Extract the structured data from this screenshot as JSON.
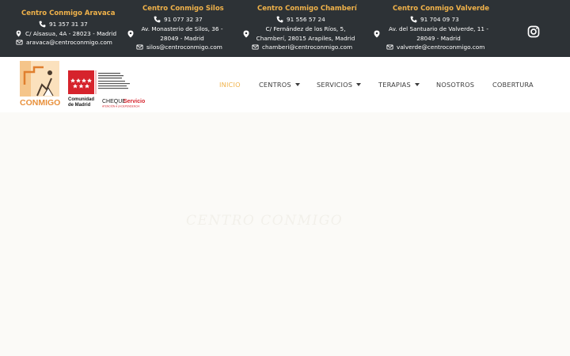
{
  "centers": [
    {
      "name": "Centro Conmigo Aravaca",
      "phone": "91 357 31 37",
      "address": "C/ Alsasua, 4A - 28023 - Madrid",
      "email": "aravaca@centroconmigo.com"
    },
    {
      "name": "Centro Conmigo Silos",
      "phone": "91 077 32 37",
      "address_l1": "Av. Monasterio de Silos, 36 -",
      "address_l2": "28049 - Madrid",
      "email": "silos@centroconmigo.com"
    },
    {
      "name": "Centro Conmigo Chamberí",
      "phone": "91 556 57 24",
      "address_l1": "C/ Fernández de los Ríos, 5,",
      "address_l2": "Chamberí, 28015 Arapiles, Madrid",
      "email": "chamberi@centroconmigo.com"
    },
    {
      "name": "Centro Conmigo Valverde",
      "phone": "91 704 09 73",
      "address_l1": "Av. del Santuario de Valverde, 11 -",
      "address_l2": "28049 - Madrid",
      "email": "valverde@centroconmigo.com"
    }
  ],
  "logos": {
    "main_text": "CONMIGO",
    "cam_text_1": "Comunidad",
    "cam_text_2": "de Madrid",
    "cheque_1": "CHEQUE",
    "cheque_2": "Servicio",
    "cheque_sub": "ATENCIÓN A LA DEPENDENCIA"
  },
  "nav": {
    "inicio": "INICIO",
    "centros": "CENTROS",
    "servicios": "SERVICIOS",
    "terapias": "TERAPIAS",
    "nosotros": "NOSOTROS",
    "cobertura": "COBERTURA"
  },
  "hero": {
    "text": "CENTRO CONMIGO"
  },
  "colors": {
    "accent": "#f0b24a",
    "topbar": "#2d3236",
    "nav_text": "#3d3d3d"
  },
  "icons": [
    "phone-icon",
    "map-pin-icon",
    "envelope-icon",
    "instagram-icon"
  ]
}
